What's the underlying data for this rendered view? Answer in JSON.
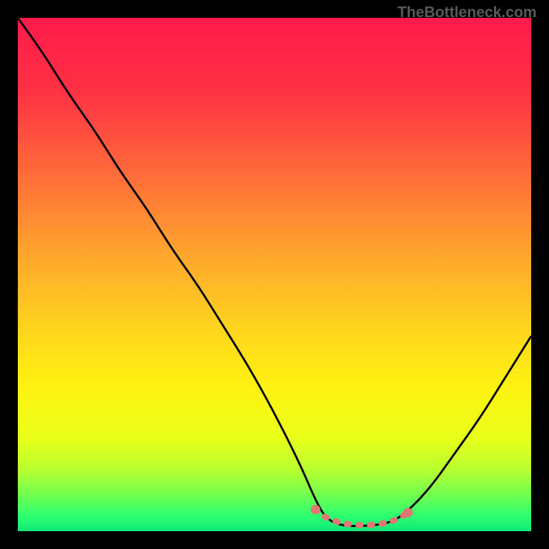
{
  "watermark": "TheBottleneck.com",
  "chart_data": {
    "type": "line",
    "title": "",
    "xlabel": "",
    "ylabel": "",
    "xlim": [
      0,
      100
    ],
    "ylim": [
      0,
      100
    ],
    "series": [
      {
        "name": "bottleneck-curve",
        "x": [
          0,
          5,
          10,
          15,
          20,
          25,
          30,
          35,
          40,
          45,
          50,
          55,
          58,
          60,
          63,
          68,
          72,
          75,
          80,
          85,
          90,
          95,
          100
        ],
        "y": [
          100,
          93,
          85,
          78,
          70,
          63,
          55,
          48,
          40,
          32,
          23,
          13,
          6,
          2.5,
          1,
          1,
          1.5,
          3,
          8,
          15,
          22,
          30,
          38
        ]
      },
      {
        "name": "optimal-region",
        "x": [
          58,
          60,
          63,
          66,
          69,
          72,
          74,
          76
        ],
        "y": [
          4.2,
          2.7,
          1.5,
          1.2,
          1.2,
          1.6,
          2.4,
          3.6
        ]
      }
    ],
    "gradient_stops": [
      {
        "offset": 0,
        "color": "#ff1a4b"
      },
      {
        "offset": 15,
        "color": "#ff3344"
      },
      {
        "offset": 30,
        "color": "#ff6a3a"
      },
      {
        "offset": 45,
        "color": "#ffa22e"
      },
      {
        "offset": 60,
        "color": "#ffd31f"
      },
      {
        "offset": 72,
        "color": "#fff210"
      },
      {
        "offset": 82,
        "color": "#e8ff1a"
      },
      {
        "offset": 88,
        "color": "#b8ff30"
      },
      {
        "offset": 93,
        "color": "#70ff50"
      },
      {
        "offset": 97,
        "color": "#2eff70"
      },
      {
        "offset": 100,
        "color": "#10e878"
      }
    ],
    "marker_color": "#e27673",
    "curve_color": "#000000"
  }
}
